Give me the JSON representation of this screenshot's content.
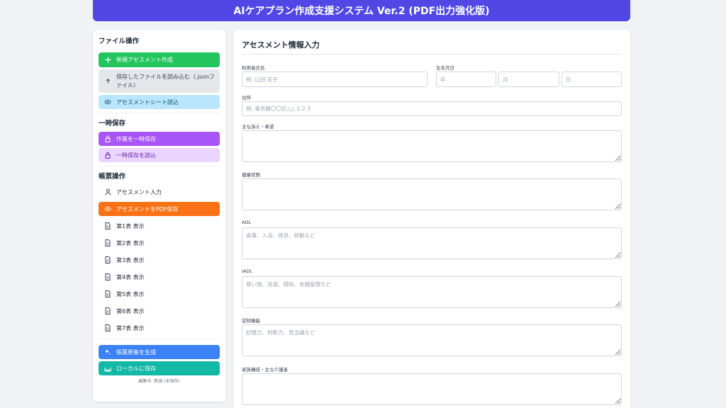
{
  "header": {
    "title": "AIケアプラン作成支援システム Ver.2 (PDF出力強化版)"
  },
  "sidebar": {
    "file_section": {
      "title": "ファイル操作",
      "new_assessment": "新規アセスメント作成",
      "load_json_line1": "保存したファイルを読み込む（.jsonフ",
      "load_json_line2": "ァイル）",
      "load_sheet": "アセスメントシート読込"
    },
    "temp_section": {
      "title": "一時保存",
      "save_temp": "作業を一時保存",
      "load_temp": "一時保存を読込"
    },
    "forms_section": {
      "title": "帳票操作",
      "assessment_input": "アセスメント入力",
      "save_pdf": "アセスメントをPDF保存",
      "tables": [
        "第1表 表示",
        "第2表 表示",
        "第3表 表示",
        "第4表 表示",
        "第5表 表示",
        "第6表 表示",
        "第7表 表示"
      ]
    },
    "generate_draft": "帳票原案を生成",
    "save_local": "ローカルに保存",
    "status": "編集中: 新規 (未保存)"
  },
  "form": {
    "title": "アセスメント情報入力",
    "name_label": "利用者氏名",
    "name_placeholder": "例: 山田 花子",
    "birth_label": "生年月日",
    "year_placeholder": "年",
    "month_placeholder": "月",
    "day_placeholder": "日",
    "address_label": "住所",
    "address_placeholder": "例: 東京都〇〇区△△ 1-2-3",
    "complaint_label": "主な訴え・希望",
    "health_label": "健康状態",
    "adl_label": "ADL",
    "adl_placeholder": "食事、入浴、排泄、移動など",
    "iadl_label": "IADL",
    "iadl_placeholder": "買い物、洗濯、掃除、金銭管理など",
    "cognitive_label": "認知機能",
    "cognitive_placeholder": "記憶力、判断力、見当識など",
    "family_label": "家族構成・主な介護者"
  },
  "colors": {
    "header": "#5147e5",
    "green": "#22c55e",
    "purple": "#a855f7",
    "orange": "#f97316",
    "blue": "#3b82f6",
    "teal": "#14b8a6"
  },
  "icons": {
    "new_assessment": "plus-icon",
    "load_json": "upload-icon",
    "load_sheet": "eye-icon",
    "save_temp": "lock-icon",
    "load_temp": "lock-icon",
    "assessment_input": "user-icon",
    "save_pdf": "eye-icon",
    "tables": "document-icon",
    "generate_draft": "sparkles-icon",
    "save_local": "save-icon"
  }
}
